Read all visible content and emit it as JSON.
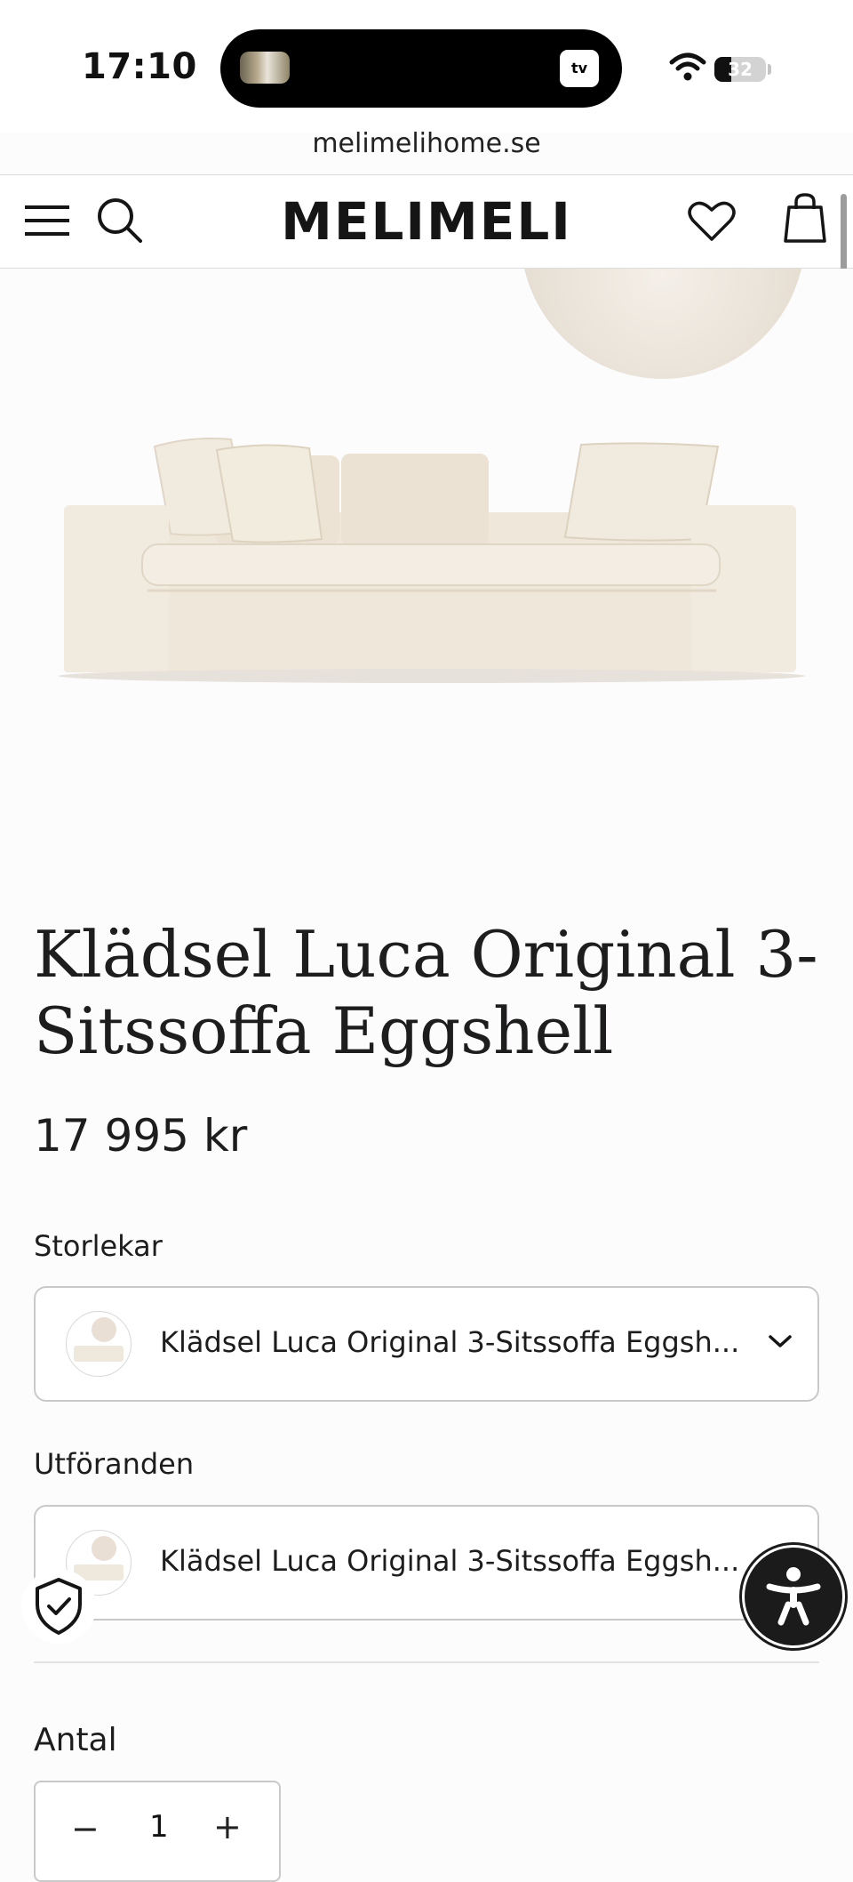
{
  "status_bar": {
    "time": "17:10",
    "tv_badge": "tv",
    "battery_level": "32",
    "url": "melimelihome.se"
  },
  "header": {
    "logo": "MELIMELI",
    "icons": [
      "menu-icon",
      "search-icon",
      "heart-icon",
      "shopping-bag-icon"
    ]
  },
  "product": {
    "title": "Klädsel Luca Original 3-Sitssoffa Eggshell",
    "price": "17 995 kr",
    "size_label": "Storlekar",
    "size_value": "Klädsel Luca Original 3-Sitssoffa Eggsh...",
    "variant_label": "Utföranden",
    "variant_value": "Klädsel Luca Original 3-Sitssoffa Eggsh...",
    "quantity_label": "Antal",
    "quantity_value": "1",
    "minus_symbol": "−",
    "plus_symbol": "+"
  },
  "colors": {
    "sofa_fabric": "#efe7d9",
    "accent_dark": "#1b1b1b",
    "border": "#c9c9c9"
  }
}
